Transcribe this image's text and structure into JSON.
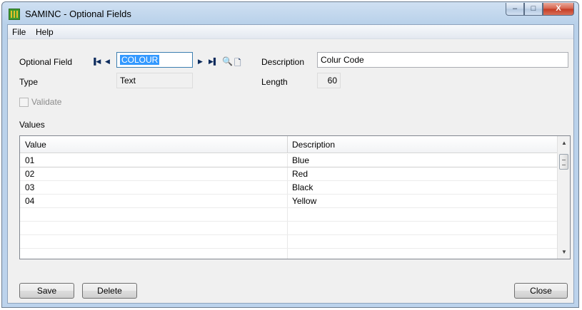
{
  "window": {
    "title": "SAMINC - Optional Fields",
    "minimize": "–",
    "maximize": "□",
    "close": "X"
  },
  "menu": [
    "File",
    "Help"
  ],
  "form": {
    "optional_field_label": "Optional Field",
    "optional_field_value": "COLOUR",
    "description_label": "Description",
    "description_value": "Colur Code",
    "type_label": "Type",
    "type_value": "Text",
    "length_label": "Length",
    "length_value": "60",
    "validate_label": "Validate",
    "values_label": "Values"
  },
  "grid": {
    "columns": [
      "Value",
      "Description"
    ],
    "rows": [
      {
        "value": "01",
        "description": "Blue"
      },
      {
        "value": "02",
        "description": "Red"
      },
      {
        "value": "03",
        "description": "Black"
      },
      {
        "value": "04",
        "description": "Yellow"
      }
    ]
  },
  "buttons": {
    "save": "Save",
    "delete": "Delete",
    "close": "Close"
  },
  "icons": {
    "first": "first-record-icon",
    "prev": "previous-record-icon",
    "next": "next-record-icon",
    "last": "last-record-icon",
    "finder": "finder-icon",
    "new": "new-document-icon"
  }
}
